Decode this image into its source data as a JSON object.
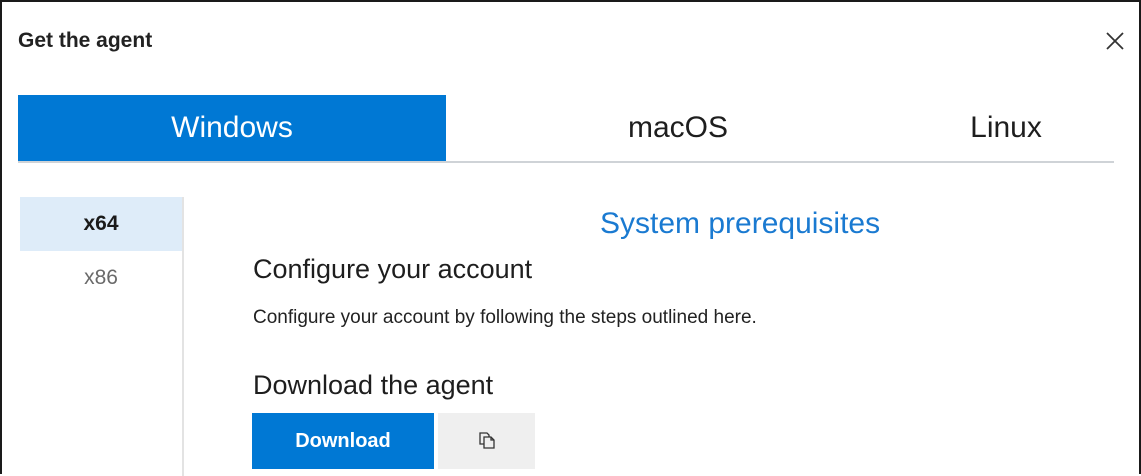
{
  "dialog": {
    "title": "Get the agent",
    "close_icon": "close-icon"
  },
  "os_tabs": [
    {
      "label": "Windows",
      "active": true
    },
    {
      "label": "macOS",
      "active": false
    },
    {
      "label": "Linux",
      "active": false
    }
  ],
  "arch_tabs": [
    {
      "label": "x64",
      "active": true
    },
    {
      "label": "x86",
      "active": false
    }
  ],
  "content": {
    "prerequisites_link": "System prerequisites",
    "configure_heading": "Configure your account",
    "configure_text": "Configure your account by following the steps outlined here.",
    "download_heading": "Download the agent",
    "download_button": "Download",
    "copy_icon": "copy-icon"
  },
  "colors": {
    "accent": "#0078d4",
    "link": "#1a7ad1",
    "arch_selected_bg": "#deecf9",
    "copy_button_bg": "#efefef"
  }
}
